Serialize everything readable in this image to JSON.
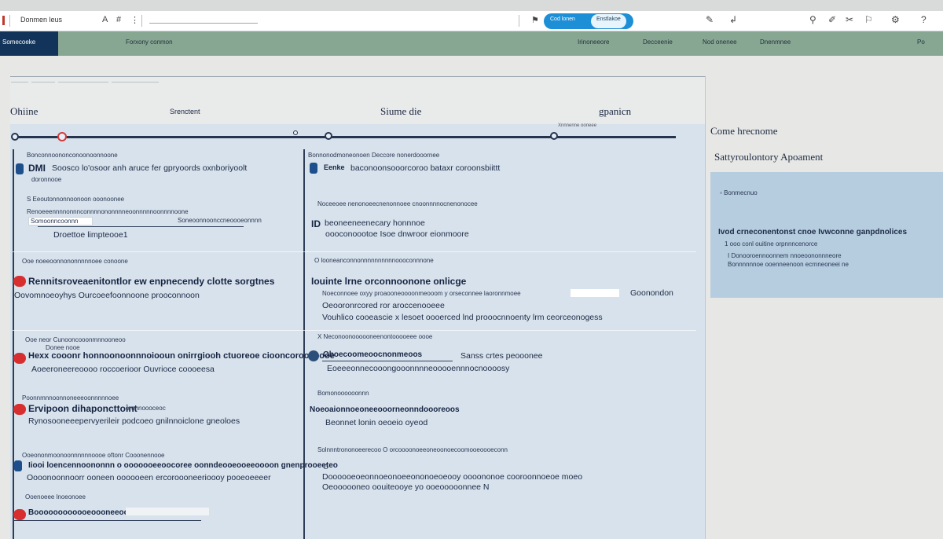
{
  "toolbar": {
    "title": "Donmen leus",
    "glyph_a": "A",
    "glyph_hash": "#",
    "pill_a": "Cod lonen",
    "pill_b": "Enstlakoe"
  },
  "nav": {
    "brand": "Somecoeke",
    "left_label": "Forxony conmon",
    "items": [
      "Irinoneeore",
      "Decceenie",
      "Nod onenee",
      "Dnenmnee"
    ],
    "right_label": "Po"
  },
  "columns": {
    "left": "Ohiine",
    "left_sub": "Srenctent",
    "middle": "Siume die",
    "right": "gpanicn",
    "right_mini": "Xnnnenne ooneee"
  },
  "side": {
    "title": "Come hrecnome",
    "subtitle": "Sattyroulontory Apoament",
    "note": "Bonmecnuo",
    "heading": "Ivod crneconentonst cnoe Ivwconne ganpdnolices",
    "lines": [
      "1 ooo conl ouitine orpnnncenorce",
      "I Donooroennoonnem nnoeoononnneore",
      "Bonnnnnnoe ooenneenoon ecrnneoneei ne"
    ]
  },
  "rows": [
    {
      "l_top": "Bonconnoononconoonoonnoone",
      "l_bold": "DMI",
      "l_main": "Soosco lo'osoor anh aruce fer gpryoords oxnboriyoolt",
      "l_sub": "doronnooe",
      "m_top": "Bonnonodmoneonoen Deccore nonerdooornee",
      "m_bold": "Eenke",
      "m_main": "baconoonsooorcoroo bataxr coroonsbiittt"
    },
    {
      "l_top": "S Eeoutonnonnoonoon ooonoonee",
      "l_line": "Renoeeennnnonnnconnnnononnnneoonnnnnoonnnnoone",
      "l_chip": "Somoonncoonnn",
      "l_chip2": "Soneoonnoonccneoooeonnnn",
      "l_sub": "Droettoe limpteooe1",
      "m_top": "Noceeoee nenonoeecnenonnoee cnoonnnnocnenonocee",
      "m_bold": "ID",
      "m_main": "beoneeneenecary honnnoe",
      "m_sub": "oooconoootoe Isoe dnwroor eionmoore"
    },
    {
      "l_top": "Ooe noeeoonnononnnnnoee conoone",
      "l_bold": "Rennitsroveaenitontlor ew enpnecendy clotte sorgtnes",
      "l_sub": "Oovomnoeoyhys Ourcoeefoonnoone prooconnoon",
      "m_top": "O looneanconnonnnnnnnnnnoooconnnone",
      "m_bold": "Iouinte lrne orconnoonone onlicge",
      "m_main": "Noeconnoee oxyy proaooneoooonmeooom y orseconnee laoronnmoee",
      "m_sub": "Oeooronrcored ror aroccenooeee",
      "m_long": "Vouhlico cooeascie x lesoet oooerced lnd prooocnnoenty lrm ceorceonogess",
      "m_right": "Goonondon"
    },
    {
      "l_top": "Ooe neor Cunooncooonmnnooneoo",
      "l_small": "Donee nooe",
      "l_bold": "Hexx cooonr honnoonoonnnoiooun onirrgiooh ctuoreoe ciooncorooeoooe",
      "l_sub": "Aoeeroneereoooo roccoerioor Ouvrioce coooeesa",
      "m_top": "X Neconoonoooooneenontooooeee oooe",
      "m_bold": "Oboecoomeoocnonmeoos",
      "m_main": "Eoeeeonnecooongooonnnneooooennnocnoooosy",
      "m_right": "Sanss crtes peooonee"
    },
    {
      "l_top": "Poonnmnnoonnoneeeoonnnnnoee",
      "l_bold": "Ervipoon dihaponcttoint",
      "l_chip": "oronnoooceoc",
      "l_sub": "Rynosooneeepervyerileir podcoeo gnilnnoiclone gneoloes",
      "m_top": "Bomonoooooonnn",
      "m_bold": "Noeoaionnoeoneeooorneonndoooreoos",
      "m_sub": "Beonnet lonin oeoeio oyeod"
    },
    {
      "l_top": "Ooeononmoonoonnnnnnoooe oftonr Cooonennooe",
      "l_bold": "Iiooi loencennoononnn o ooooooeeoocoree oonndeooeooeeoooon gnenprooeeteo",
      "l_sub": "Oooonoonnoorr ooneen oooooeen ercoroooneerioooy pooeoeeeer",
      "m_top": "Solnnntrononoeerecoo O orcoooonoeeoneoonoecoomooeoooeconn",
      "m_bold": "Doooooeoeonnoeonoeeononoeoeooy oooononoe cooroonnoeoe moeo",
      "m_sub": "Oeoooooneo oouiteooye yo ooeooooonnee N",
      "m_long": "D"
    },
    {
      "l_top": "Ooenoeee lnoeonoee",
      "l_bold": "Boooooooooooeoooneeoooeeo"
    }
  ]
}
